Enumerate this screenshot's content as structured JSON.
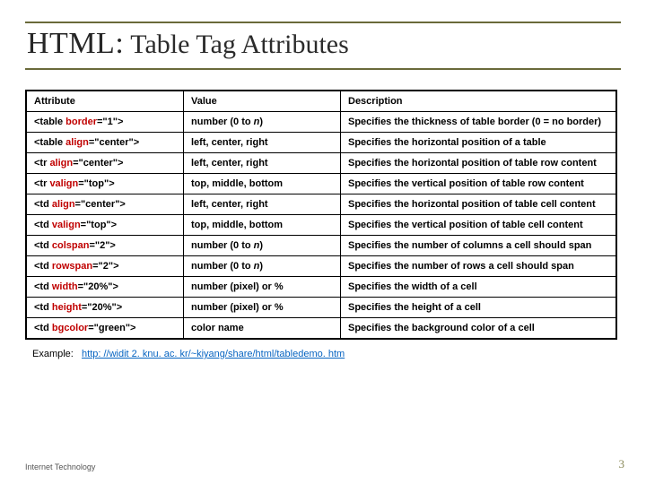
{
  "title_prefix": "HTML:",
  "title_rest": " Table Tag Attributes",
  "headers": {
    "attribute": "Attribute",
    "value": "Value",
    "description": "Description"
  },
  "rows": [
    {
      "tag_open": "<table ",
      "attr": "border",
      "tag_close": "=\"1\">",
      "value_plain": "number (0 to ",
      "value_italic": "n",
      "value_tail": ")",
      "desc": "Specifies the thickness of table border (0 = no border)"
    },
    {
      "tag_open": "<table ",
      "attr": "align",
      "tag_close": "=\"center\">",
      "value_plain": "left, center, right",
      "value_italic": "",
      "value_tail": "",
      "desc": "Specifies the horizontal position of a table"
    },
    {
      "tag_open": "<tr ",
      "attr": "align",
      "tag_close": "=\"center\">",
      "value_plain": "left, center, right",
      "value_italic": "",
      "value_tail": "",
      "desc": "Specifies the horizontal position of table row content"
    },
    {
      "tag_open": "<tr ",
      "attr": "valign",
      "tag_close": "=\"top\">",
      "value_plain": "top, middle, bottom",
      "value_italic": "",
      "value_tail": "",
      "desc": "Specifies the vertical position of table row content"
    },
    {
      "tag_open": "<td ",
      "attr": "align",
      "tag_close": "=\"center\">",
      "value_plain": "left, center, right",
      "value_italic": "",
      "value_tail": "",
      "desc": "Specifies the horizontal position of table cell content"
    },
    {
      "tag_open": "<td ",
      "attr": "valign",
      "tag_close": "=\"top\">",
      "value_plain": "top, middle, bottom",
      "value_italic": "",
      "value_tail": "",
      "desc": "Specifies the vertical position of table cell content"
    },
    {
      "tag_open": "<td ",
      "attr": "colspan",
      "tag_close": "=\"2\">",
      "value_plain": "number (0 to ",
      "value_italic": "n",
      "value_tail": ")",
      "desc": "Specifies the number of columns a cell should span"
    },
    {
      "tag_open": "<td ",
      "attr": "rowspan",
      "tag_close": "=\"2\">",
      "value_plain": "number (0 to ",
      "value_italic": "n",
      "value_tail": ")",
      "desc": "Specifies the number of rows a cell should span"
    },
    {
      "tag_open": "<td ",
      "attr": "width",
      "tag_close": "=\"20%\">",
      "value_plain": "number (pixel) or %",
      "value_italic": "",
      "value_tail": "",
      "desc": "Specifies the width of a cell"
    },
    {
      "tag_open": "<td ",
      "attr": "height",
      "tag_close": "=\"20%\">",
      "value_plain": "number (pixel) or %",
      "value_italic": "",
      "value_tail": "",
      "desc": "Specifies the height of a cell"
    },
    {
      "tag_open": "<td ",
      "attr": "bgcolor",
      "tag_close": "=\"green\">",
      "value_plain": "color name",
      "value_italic": "",
      "value_tail": "",
      "desc": "Specifies the background color of a cell"
    }
  ],
  "example_label": "Example:",
  "example_link_text": "http: //widit 2. knu. ac. kr/~kiyang/share/html/tabledemo. htm",
  "footer_left": "Internet Technology",
  "footer_right": "3"
}
